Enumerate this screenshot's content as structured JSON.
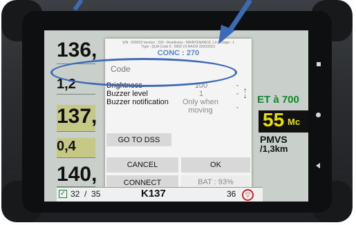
{
  "dialog": {
    "info_line1": "S/N : 000019 Version : 329 - Readiness : MAINTENANCE 1.0.5 Stage : 1",
    "info_line2": "Type : QUA Code 5 : 0000 V3 RACM 2020/2021",
    "conc_label": "CONC : 270",
    "code_placeholder": "Code",
    "settings": [
      {
        "label": "Brightness",
        "value": "100"
      },
      {
        "label": "Buzzer level",
        "value": "1"
      },
      {
        "label": "Buzzer notification",
        "value": "Only when moving"
      }
    ],
    "goto_dss": "GO TO DSS",
    "cancel": "CANCEL",
    "ok": "OK",
    "connect": "CONNECT",
    "battery": "BAT : 93%"
  },
  "left_panel": {
    "values": [
      "136,",
      "1,2",
      "137,",
      "0,4",
      "140,"
    ]
  },
  "right_panel": {
    "line1": "ET à 700",
    "line2": "55",
    "line2_unit": "Mc",
    "line3": "PMVS",
    "line4": "/1,3km"
  },
  "status_bar": {
    "count": "32  /  35",
    "route": "K137",
    "number": "36"
  },
  "colors": {
    "accent": "#3d6ab7",
    "highlight": "#c6c886",
    "yellow": "#e8e000",
    "green_text": "#0d8a2a"
  }
}
